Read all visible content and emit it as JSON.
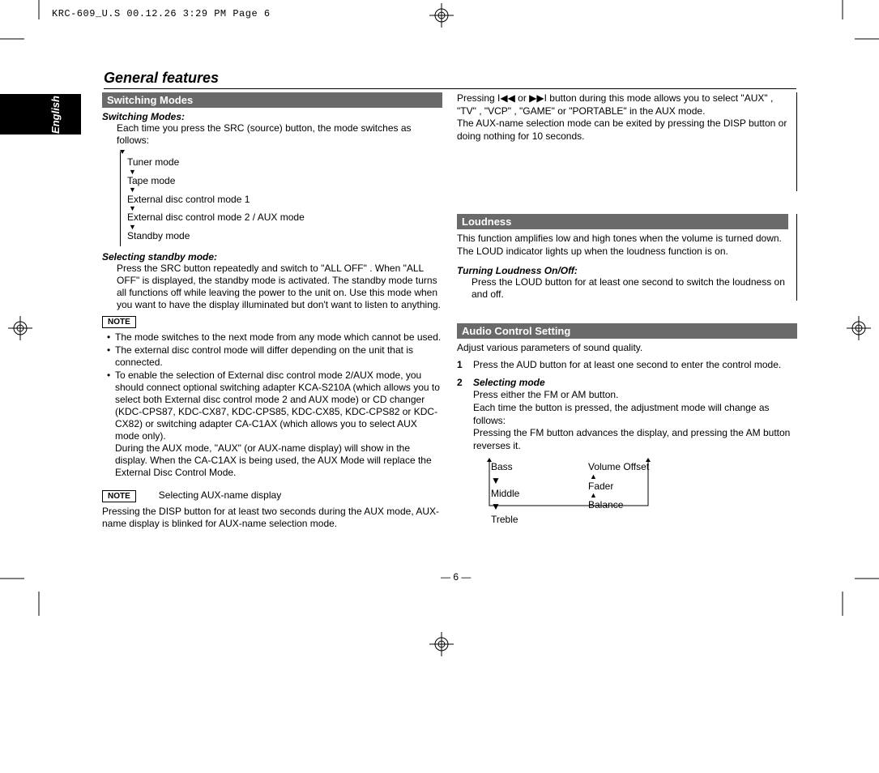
{
  "print_header": "KRC-609_U.S  00.12.26 3:29 PM  Page 6",
  "language_tab": "English",
  "page_title": "General features",
  "page_number": "— 6 —",
  "left": {
    "section1_title": "Switching Modes",
    "switching_modes_heading": "Switching Modes:",
    "switching_modes_body": "Each time you press the SRC (source) button, the mode switches as follows:",
    "modes": {
      "m1": "Tuner mode",
      "m2": "Tape mode",
      "m3": "External disc control mode 1",
      "m4": "External disc control mode 2 / AUX mode",
      "m5": "Standby mode"
    },
    "standby_heading": "Selecting standby mode:",
    "standby_body": "Press the SRC button repeatedly and switch to \"ALL OFF\" . When \"ALL OFF\" is displayed, the standby mode is activated. The standby mode turns all functions off while leaving the power to the unit on. Use this mode when you want to have the display illuminated but don't want to listen to anything.",
    "note_label": "NOTE",
    "bullets": {
      "b1": "The mode switches to the next mode from any mode which cannot be used.",
      "b2": "The external disc control mode will differ depending on the unit that is connected.",
      "b3": "To enable the selection of External disc control mode 2/AUX mode, you should connect optional switching adapter KCA-S210A (which allows you to select both External disc control mode 2 and AUX mode) or CD changer (KDC-CPS87, KDC-CX87, KDC-CPS85, KDC-CX85, KDC-CPS82 or KDC-CX82) or switching adapter CA-C1AX (which allows you to select AUX mode only).",
      "b3b": "During the AUX mode, \"AUX\" (or AUX-name display) will show in the display. When the CA-C1AX is being used, the AUX Mode will replace the External Disc Control Mode."
    },
    "note2_heading": "Selecting AUX-name display",
    "note2_body": "Pressing the DISP button for at least two seconds during the AUX mode, AUX-name display is blinked for AUX-name selection mode."
  },
  "right": {
    "top_body1": "Pressing ",
    "top_body1b": " or ",
    "top_body1c": " button during this mode allows you to select \"AUX\" , \"TV\" , \"VCP\" , \"GAME\" or \"PORTABLE\" in the AUX mode.",
    "top_body2": "The AUX-name selection mode can be exited by pressing the DISP button or doing nothing for 10 seconds.",
    "loudness_title": "Loudness",
    "loudness_body1": "This function amplifies low and high tones when the volume is turned down.",
    "loudness_body2": "The LOUD indicator lights up when the loudness function is on.",
    "loudness_sub": "Turning Loudness On/Off:",
    "loudness_sub_body": "Press the LOUD button for at least one second to switch the loudness on and off.",
    "audio_title": "Audio Control Setting",
    "audio_body": "Adjust various parameters of sound quality.",
    "step1": "Press the AUD button for at least one second to enter the control mode.",
    "step2_heading": "Selecting mode",
    "step2_l1": "Press either the FM or AM button.",
    "step2_l2": "Each time the button is pressed, the adjustment mode will change as follows:",
    "step2_l3": "Pressing the FM button advances the display, and pressing the AM button reverses it.",
    "audio_modes": {
      "l1": "Bass",
      "l2": "Middle",
      "l3": "Treble",
      "r1": "Volume Offset",
      "r2": "Fader",
      "r3": "Balance"
    }
  }
}
